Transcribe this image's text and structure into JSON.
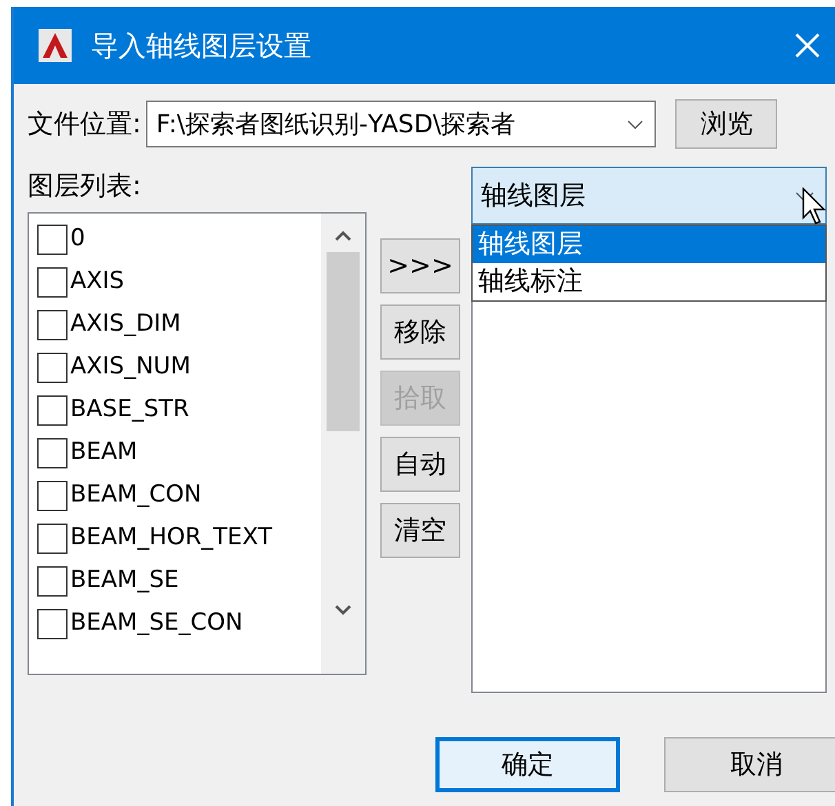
{
  "window": {
    "title": "导入轴线图层设置"
  },
  "file_location": {
    "label": "文件位置:",
    "value": "F:\\探索者图纸识别-YASD\\探索者",
    "browse_button": "浏览"
  },
  "layer_list": {
    "label": "图层列表:",
    "items": [
      {
        "label": "0",
        "checked": false
      },
      {
        "label": "AXIS",
        "checked": false
      },
      {
        "label": "AXIS_DIM",
        "checked": false
      },
      {
        "label": "AXIS_NUM",
        "checked": false
      },
      {
        "label": "BASE_STR",
        "checked": false
      },
      {
        "label": "BEAM",
        "checked": false
      },
      {
        "label": "BEAM_CON",
        "checked": false
      },
      {
        "label": "BEAM_HOR_TEXT",
        "checked": false
      },
      {
        "label": "BEAM_SE",
        "checked": false
      },
      {
        "label": "BEAM_SE_CON",
        "checked": false
      }
    ]
  },
  "middle_buttons": [
    {
      "label": ">>>",
      "disabled": false
    },
    {
      "label": "移除",
      "disabled": false
    },
    {
      "label": "拾取",
      "disabled": true
    },
    {
      "label": "自动",
      "disabled": false
    },
    {
      "label": "清空",
      "disabled": false
    }
  ],
  "layer_type": {
    "value": "轴线图层",
    "expanded": true,
    "options": [
      {
        "label": "轴线图层",
        "selected": true
      },
      {
        "label": "轴线标注",
        "selected": false
      }
    ]
  },
  "footer_buttons": [
    {
      "label": "确定",
      "focused": true
    },
    {
      "label": "取消",
      "focused": false
    }
  ]
}
